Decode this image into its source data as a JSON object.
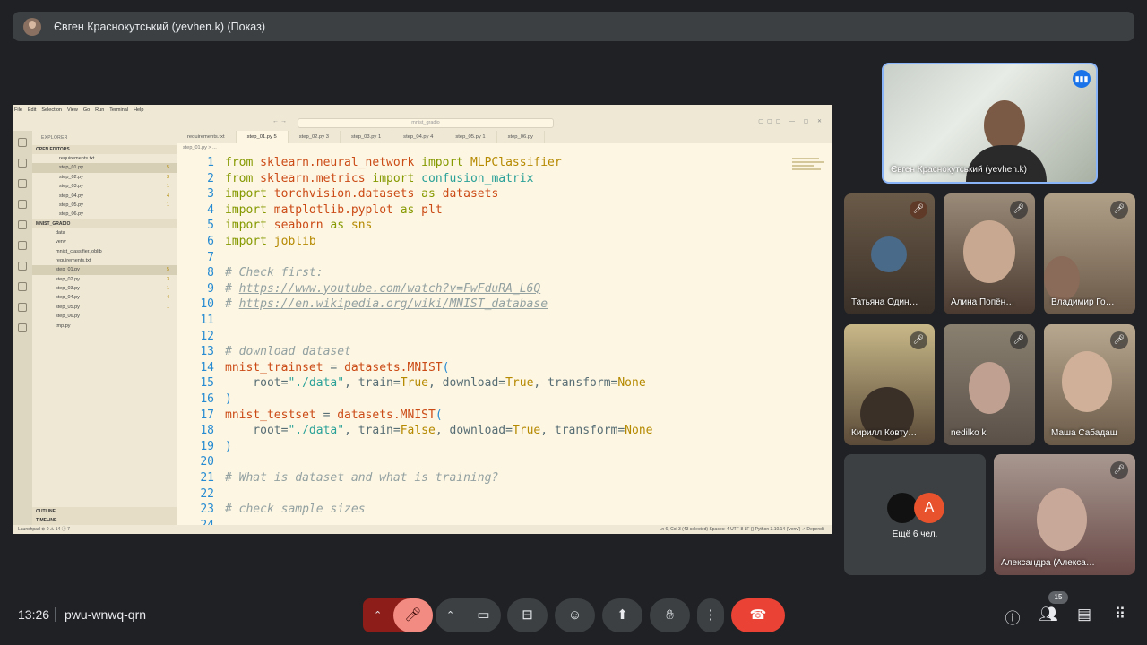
{
  "meeting": {
    "presenter_title": "Євген Краснокутський (yevhen.k) (Показ)",
    "time": "13:26",
    "code": "pwu-wnwq-qrn",
    "participant_count": "15"
  },
  "vscode": {
    "menu": [
      "File",
      "Edit",
      "Selection",
      "View",
      "Go",
      "Run",
      "Terminal",
      "Help"
    ],
    "search": "mnist_gradio",
    "explorer_header": "EXPLORER",
    "open_editors_label": "OPEN EDITORS",
    "open_editors": [
      {
        "name": "requirements.txt",
        "n": ""
      },
      {
        "name": "step_01.py",
        "n": "5"
      },
      {
        "name": "step_02.py",
        "n": "3"
      },
      {
        "name": "step_03.py",
        "n": "1"
      },
      {
        "name": "step_04.py",
        "n": "4"
      },
      {
        "name": "step_05.py",
        "n": "1"
      },
      {
        "name": "step_06.py",
        "n": ""
      }
    ],
    "folder_label": "MNIST_GRADIO",
    "files": [
      {
        "name": "data",
        "n": ""
      },
      {
        "name": "venv",
        "n": ""
      },
      {
        "name": "mnist_classifier.joblib",
        "n": ""
      },
      {
        "name": "requirements.txt",
        "n": ""
      },
      {
        "name": "step_01.py",
        "n": "5"
      },
      {
        "name": "step_02.py",
        "n": "3"
      },
      {
        "name": "step_03.py",
        "n": "1"
      },
      {
        "name": "step_04.py",
        "n": "4"
      },
      {
        "name": "step_05.py",
        "n": "1"
      },
      {
        "name": "step_06.py",
        "n": ""
      },
      {
        "name": "tmp.py",
        "n": ""
      }
    ],
    "outline_label": "OUTLINE",
    "timeline_label": "TIMELINE",
    "tabs": [
      "requirements.txt",
      "step_01.py 5",
      "step_02.py 3",
      "step_03.py 1",
      "step_04.py 4",
      "step_05.py 1",
      "step_06.py"
    ],
    "breadcrumb": "step_01.py > ...",
    "line_numbers": [
      "1",
      "2",
      "3",
      "4",
      "5",
      "6",
      "7",
      "8",
      "9",
      "10",
      "11",
      "12",
      "13",
      "14",
      "15",
      "16",
      "17",
      "18",
      "19",
      "20",
      "21",
      "22",
      "23",
      "24"
    ],
    "status_left": "Launchpad  ⊗ 0 ⚠ 14 ⓘ 7",
    "status_right": "Ln 6, Col 3 (43 selected)   Spaces: 4   UTF-8   LF   {} Python   3.10.14 ('venv')   ✓ Dependi"
  },
  "participants": {
    "featured": "Євген Краснокутський (yevhen.k)",
    "tiles": [
      "Татьяна Один…",
      "Алина Попён…",
      "Владимир Го…",
      "Кирилл Ковту…",
      "nedilko k",
      "Маша Сабадаш",
      "Александра (Алекса…"
    ],
    "more": "Ещё 6 чел.",
    "more_initial": "A"
  },
  "colors": {
    "bg": "#202124",
    "tile": "#3c4043",
    "end_call": "#ea4335",
    "mic_off": "#c5221f",
    "accent": "#8ab4f8"
  },
  "icons": [
    "mic-off-icon",
    "camera-icon",
    "captions-icon",
    "emoji-icon",
    "present-icon",
    "hand-icon",
    "more-icon",
    "end-call-icon",
    "info-icon",
    "people-icon",
    "chat-icon",
    "apps-icon"
  ]
}
